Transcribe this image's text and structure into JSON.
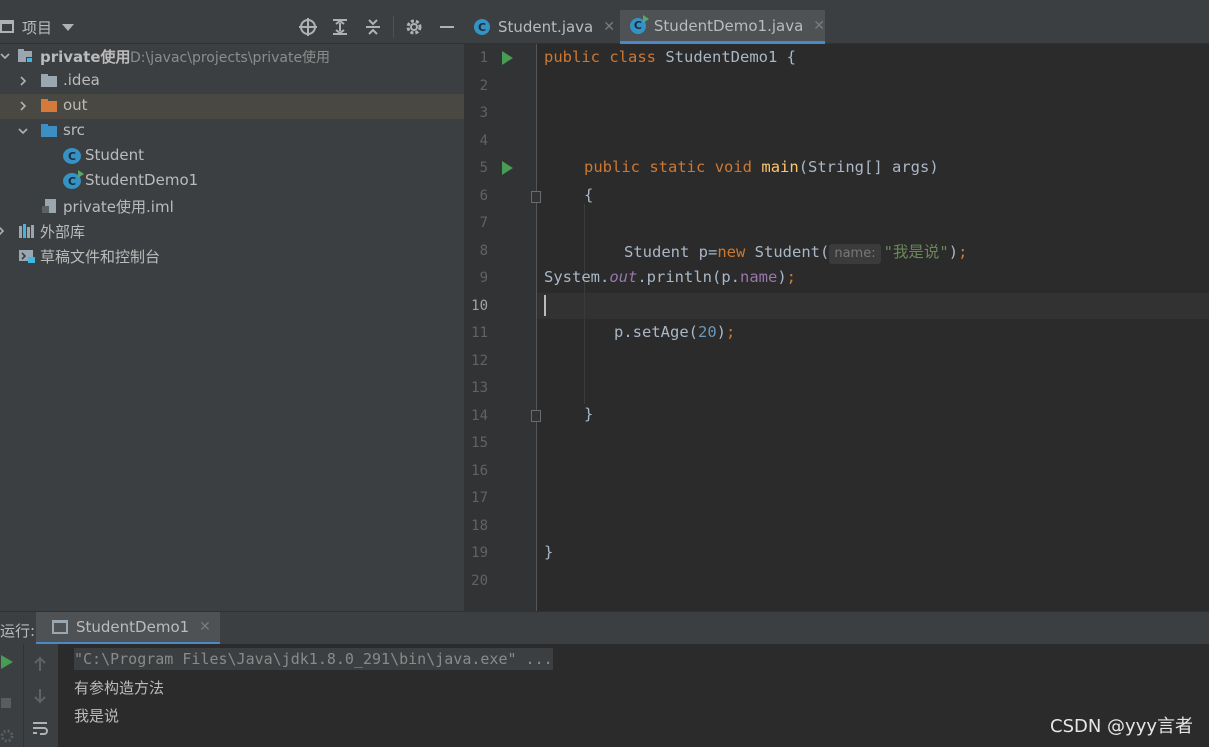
{
  "project_panel": {
    "title": "项目",
    "tree": [
      {
        "label": "private使用",
        "path": "D:\\javac\\projects\\private使用",
        "icon": "module-folder-icon",
        "bold": true
      },
      {
        "label": ".idea",
        "icon": "folder-icon"
      },
      {
        "label": "out",
        "icon": "folder-orange-icon",
        "selected": true
      },
      {
        "label": "src",
        "icon": "source-folder-icon"
      },
      {
        "label": "Student",
        "icon": "java-class-icon"
      },
      {
        "label": "StudentDemo1",
        "icon": "java-class-runnable-icon"
      },
      {
        "label": "private使用.iml",
        "icon": "iml-file-icon"
      },
      {
        "label": "外部库",
        "icon": "library-icon"
      },
      {
        "label": "草稿文件和控制台",
        "icon": "scratches-icon"
      }
    ]
  },
  "tabs": [
    {
      "label": "Student.java",
      "close": "✕",
      "active": false
    },
    {
      "label": "StudentDemo1.java",
      "close": "✕",
      "active": true
    }
  ],
  "editor": {
    "line_numbers": [
      "1",
      "2",
      "3",
      "4",
      "5",
      "6",
      "7",
      "8",
      "9",
      "10",
      "11",
      "12",
      "13",
      "14",
      "15",
      "16",
      "17",
      "18",
      "19",
      "20"
    ],
    "current_line": "10",
    "code": {
      "l1_kw1": "public",
      "l1_kw2": "class",
      "l1_rest": " StudentDemo1 {",
      "l5_kw1": "public",
      "l5_kw2": "static",
      "l5_kw3": "void",
      "l5_fn": "main",
      "l5_rest": "(String[] args)",
      "l6": "{",
      "l8_pre": "Student p=",
      "l8_kw": "new",
      "l8_mid": " Student(",
      "l8_hint": "name:",
      "l8_str": "\"我是说\"",
      "l8_end": ")",
      "l8_semi": ";",
      "l9_pre": "System.",
      "l9_static": "out",
      "l9_mid": ".println(p.",
      "l9_field": "name",
      "l9_end": ")",
      "l9_semi": ";",
      "l11_pre": "p.setAge(",
      "l11_num": "20",
      "l11_end": ")",
      "l11_semi": ";",
      "l14": "}",
      "l19": "}"
    }
  },
  "run_panel": {
    "label": "运行:",
    "tab_label": "StudentDemo1",
    "tab_close": "✕",
    "console_lines": [
      "\"C:\\Program Files\\Java\\jdk1.8.0_291\\bin\\java.exe\" ...",
      "有参构造方法",
      "我是说"
    ]
  },
  "watermark": "CSDN @yyy言者",
  "colors": {
    "keyword": "#cc7832",
    "function": "#ffc66d",
    "string": "#6a8759",
    "number": "#6897bb",
    "field": "#9876aa",
    "accent": "#4a88c7",
    "run_green": "#499c54"
  }
}
